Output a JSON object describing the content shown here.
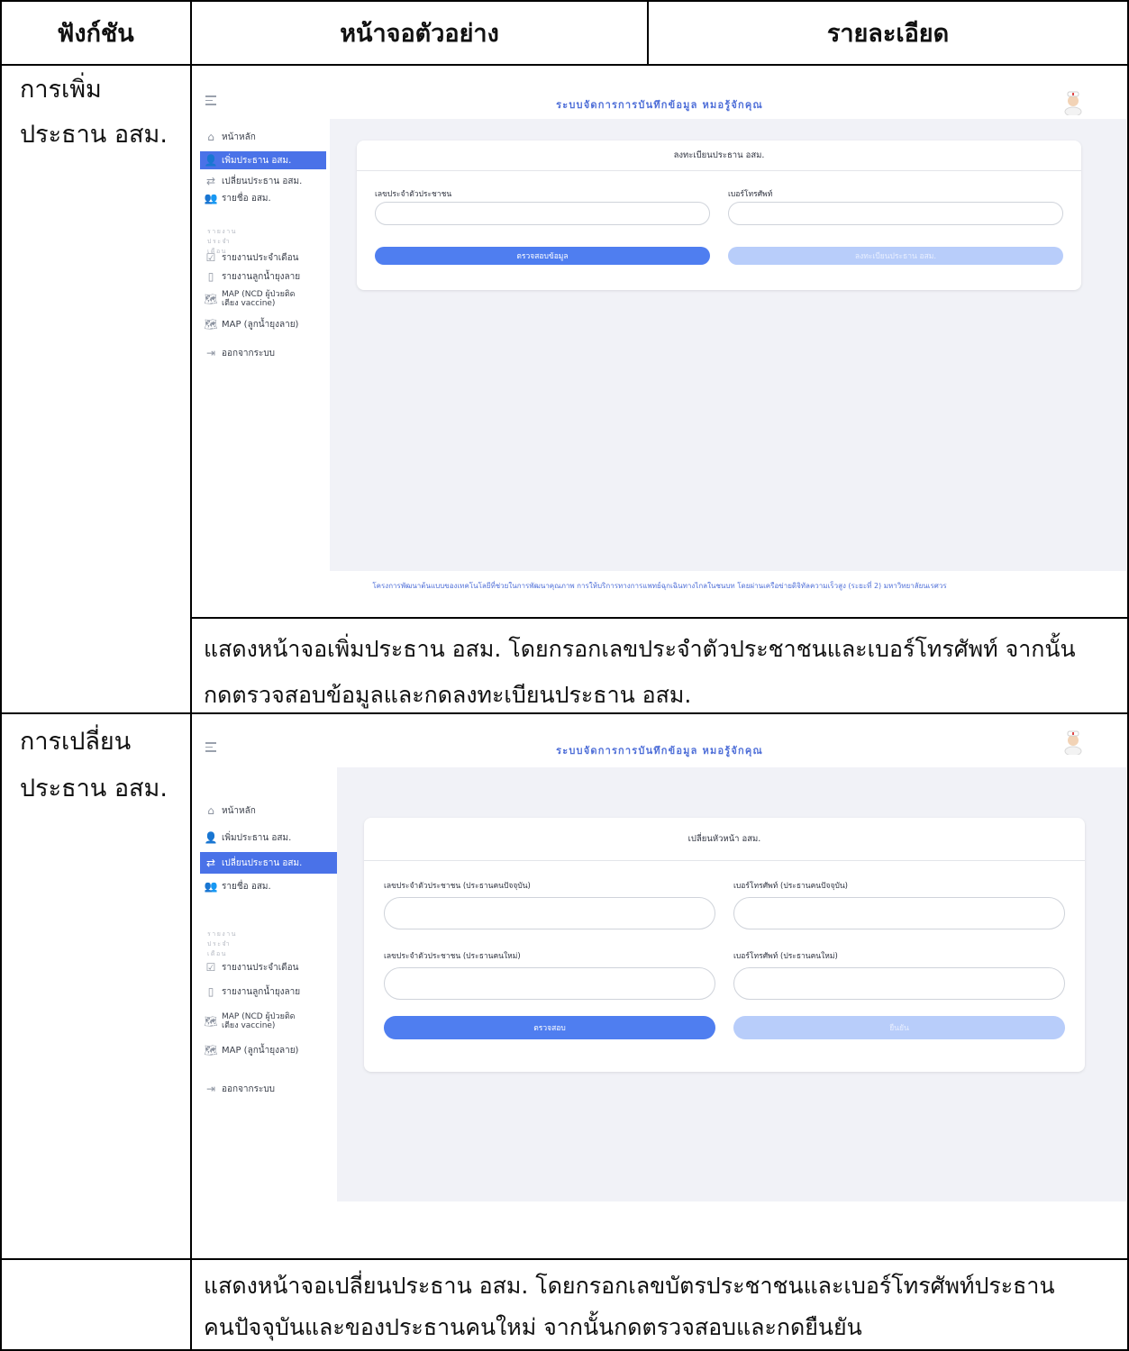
{
  "table": {
    "headers": [
      "ฟังก์ชัน",
      "หน้าจอตัวอย่าง",
      "รายละเอียด"
    ]
  },
  "rows": [
    {
      "function_lines": [
        "การเพิ่ม",
        "ประธาน อสม."
      ],
      "description_lines": [
        "แสดงหน้าจอเพิ่มประธาน อสม. โดยกรอกเลขประจำตัวประชาชนและเบอร์โทรศัพท์ จากนั้น",
        "กดตรวจสอบข้อมูลและกดลงทะเบียนประธาน อสม."
      ],
      "screen": {
        "app_title": "ระบบจัดการการบันทึกข้อมูล หมอรู้จักคุณ",
        "sidebar": {
          "items": [
            "หน้าหลัก",
            "เพิ่มประธาน อสม.",
            "เปลี่ยนประธาน อสม.",
            "รายชื่อ อสม."
          ],
          "section": "รายงานประจำเดือน",
          "report_items": [
            "รายงานประจำเดือน",
            "รายงานลูกน้ำยุงลาย",
            "MAP (NCD ผู้ป่วยติดเตียง vaccine)",
            "MAP (ลูกน้ำยุงลาย)"
          ],
          "logout": "ออกจากระบบ",
          "active_index": 1
        },
        "card": {
          "title": "ลงทะเบียนประธาน อสม.",
          "fields": [
            {
              "label": "เลขประจำตัวประชาชน",
              "value": ""
            },
            {
              "label": "เบอร์โทรศัพท์",
              "value": ""
            }
          ],
          "buttons": {
            "primary": "ตรวจสอบข้อมูล",
            "secondary": "ลงทะเบียนประธาน อสม."
          }
        },
        "footer": "โครงการพัฒนาต้นแบบของเทคโนโลยีที่ช่วยในการพัฒนาคุณภาพ การให้บริการทางการแพทย์ฉุกเฉินทางไกลในชนบท โดยผ่านเครือข่ายดิจิทัลความเร็วสูง (ระยะที่ 2) มหาวิทยาลัยนเรศวร"
      }
    },
    {
      "function_lines": [
        "การเปลี่ยน",
        "ประธาน อสม."
      ],
      "description_lines": [
        "แสดงหน้าจอเปลี่ยนประธาน อสม. โดยกรอกเลขบัตรประชาชนและเบอร์โทรศัพท์ประธาน",
        "คนปัจจุบันและของประธานคนใหม่ จากนั้นกดตรวจสอบและกดยืนยัน"
      ],
      "screen": {
        "app_title": "ระบบจัดการการบันทึกข้อมูล หมอรู้จักคุณ",
        "sidebar": {
          "items": [
            "หน้าหลัก",
            "เพิ่มประธาน อสม.",
            "เปลี่ยนประธาน อสม.",
            "รายชื่อ อสม."
          ],
          "section": "รายงานประจำเดือน",
          "report_items": [
            "รายงานประจำเดือน",
            "รายงานลูกน้ำยุงลาย",
            "MAP (NCD ผู้ป่วยติดเตียง vaccine)",
            "MAP (ลูกน้ำยุงลาย)"
          ],
          "logout": "ออกจากระบบ",
          "active_index": 2
        },
        "card": {
          "title": "เปลี่ยนหัวหน้า อสม.",
          "fields": [
            {
              "label": "เลขประจำตัวประชาชน (ประธานคนปัจจุบัน)",
              "value": ""
            },
            {
              "label": "เบอร์โทรศัพท์ (ประธานคนปัจจุบัน)",
              "value": ""
            },
            {
              "label": "เลขประจำตัวประชาชน (ประธานคนใหม่)",
              "value": ""
            },
            {
              "label": "เบอร์โทรศัพท์ (ประธานคนใหม่)",
              "value": ""
            }
          ],
          "buttons": {
            "primary": "ตรวจสอบ",
            "secondary": "ยืนยัน"
          }
        }
      }
    }
  ]
}
